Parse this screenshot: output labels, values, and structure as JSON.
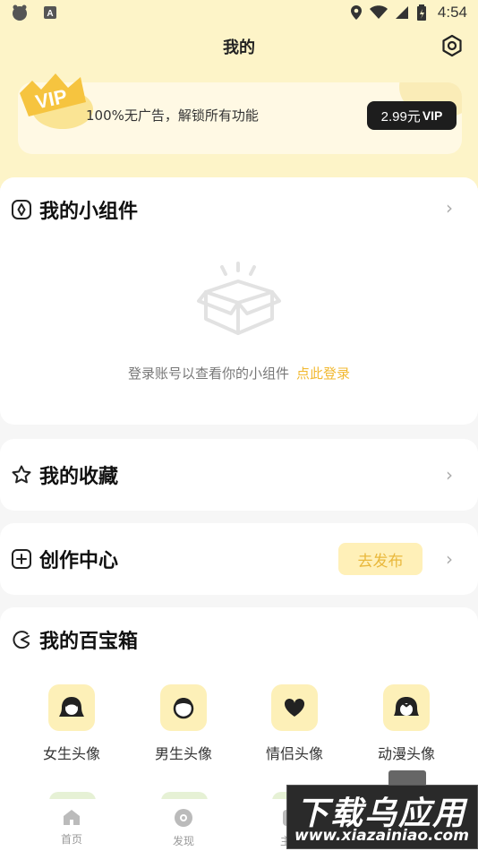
{
  "status_bar": {
    "time": "4:54"
  },
  "header": {
    "title": "我的"
  },
  "vip": {
    "badge": "VIP",
    "description": "100%无广告，解锁所有功能",
    "price": "2.99元",
    "price_suffix": "VIP"
  },
  "widgets": {
    "title": "我的小组件",
    "empty_text": "登录账号以查看你的小组件",
    "login_link": "点此登录"
  },
  "favorites": {
    "title": "我的收藏"
  },
  "creation": {
    "title": "创作中心",
    "publish_label": "去发布"
  },
  "toolbox": {
    "title": "我的百宝箱",
    "items": [
      {
        "label": "女生头像",
        "icon": "girl-avatar-icon"
      },
      {
        "label": "男生头像",
        "icon": "boy-avatar-icon"
      },
      {
        "label": "情侣头像",
        "icon": "heart-icon"
      },
      {
        "label": "动漫头像",
        "icon": "anime-avatar-icon"
      }
    ]
  },
  "tabbar": {
    "tabs": [
      {
        "label": "首页",
        "icon": "home-icon"
      },
      {
        "label": "发现",
        "icon": "discover-icon"
      },
      {
        "label": "主题",
        "icon": "theme-icon"
      }
    ]
  },
  "watermark": {
    "title": "下载乌应用",
    "url": "www.xiazainiao.com"
  },
  "colors": {
    "accent": "#f2b931",
    "top_bg": "#fdf4c8",
    "icon_bg": "#fdf0b8"
  }
}
